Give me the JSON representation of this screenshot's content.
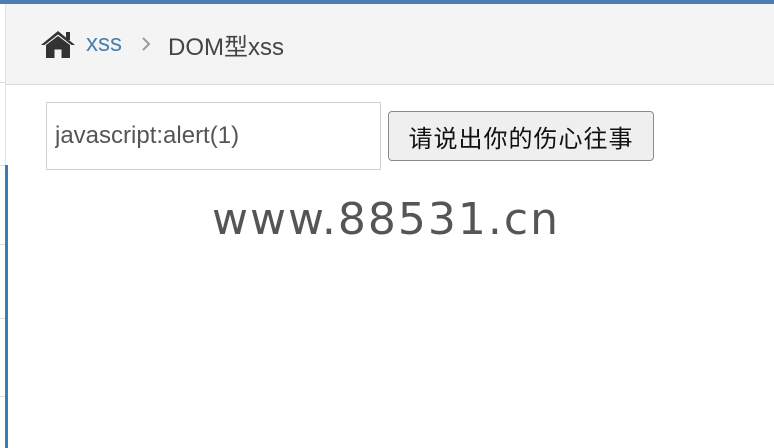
{
  "breadcrumbs": {
    "home_icon": "home-icon",
    "link": "xss",
    "separator_icon": "chevron-right-icon",
    "current": "DOM型xss"
  },
  "form": {
    "input_value": "javascript:alert(1)",
    "button_label": "请说出你的伤心往事"
  },
  "watermark": {
    "text": "www.88531.cn"
  },
  "colors": {
    "accent": "#4a7fb0",
    "breadcrumb_bg": "#f4f4f4",
    "text": "#444444"
  }
}
